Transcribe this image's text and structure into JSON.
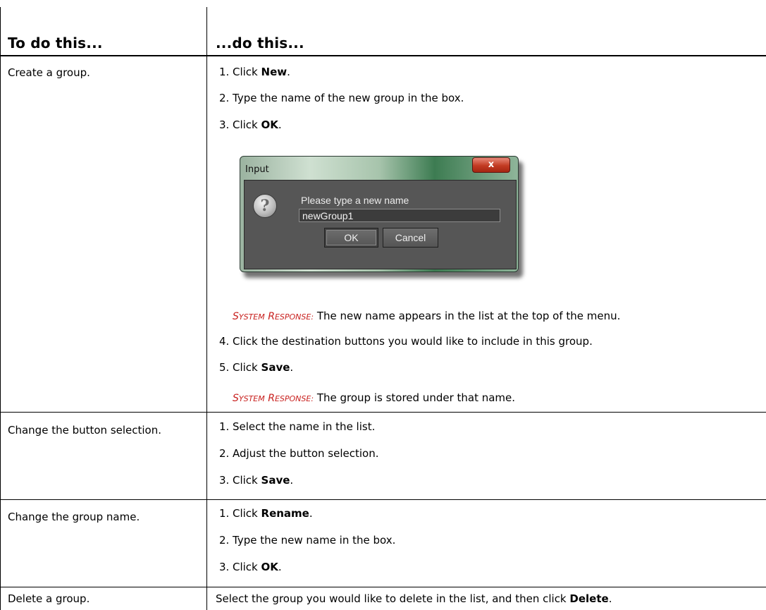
{
  "table": {
    "headers": [
      "To do this...",
      "...do this..."
    ],
    "rows": [
      {
        "task": "Create a group.",
        "steps": [
          {
            "num": "1.",
            "pre": "Click ",
            "bold": "New",
            "post": "."
          },
          {
            "num": "2.",
            "pre": "Type the name of the new group in the box.",
            "bold": "",
            "post": ""
          },
          {
            "num": "3.",
            "pre": "Click ",
            "bold": "OK",
            "post": "."
          },
          {
            "num": "4.",
            "pre": "Click the destination buttons you would like to include in this group.",
            "bold": "",
            "post": ""
          },
          {
            "num": "5.",
            "pre": "Click ",
            "bold": "Save",
            "post": "."
          }
        ],
        "responses": [
          {
            "label": "System Response:",
            "text": "The new name appears in the list at the top of the menu."
          },
          {
            "label": "System Response:",
            "text": "The group is stored under that name."
          }
        ]
      },
      {
        "task": "Change the button selection.",
        "steps": [
          {
            "num": "1.",
            "pre": "Select the name in the list.",
            "bold": "",
            "post": ""
          },
          {
            "num": "2.",
            "pre": "Adjust the button selection.",
            "bold": "",
            "post": ""
          },
          {
            "num": "3.",
            "pre": "Click ",
            "bold": "Save",
            "post": "."
          }
        ]
      },
      {
        "task": "Change the group name.",
        "steps": [
          {
            "num": "1.",
            "pre": "Click ",
            "bold": "Rename",
            "post": "."
          },
          {
            "num": "2.",
            "pre": "Type the new name in the box.",
            "bold": "",
            "post": ""
          },
          {
            "num": "3.",
            "pre": "Click ",
            "bold": "OK",
            "post": "."
          }
        ]
      },
      {
        "task": "Delete a group.",
        "text_pre": "Select the group you would like to delete in the list, and then click ",
        "text_bold": "Delete",
        "text_post": "."
      }
    ]
  },
  "dialog": {
    "title": "Input",
    "close_label": "x",
    "prompt": "Please type a new name",
    "input_value": "newGroup1",
    "ok_label": "OK",
    "cancel_label": "Cancel",
    "icon": "question-icon"
  }
}
